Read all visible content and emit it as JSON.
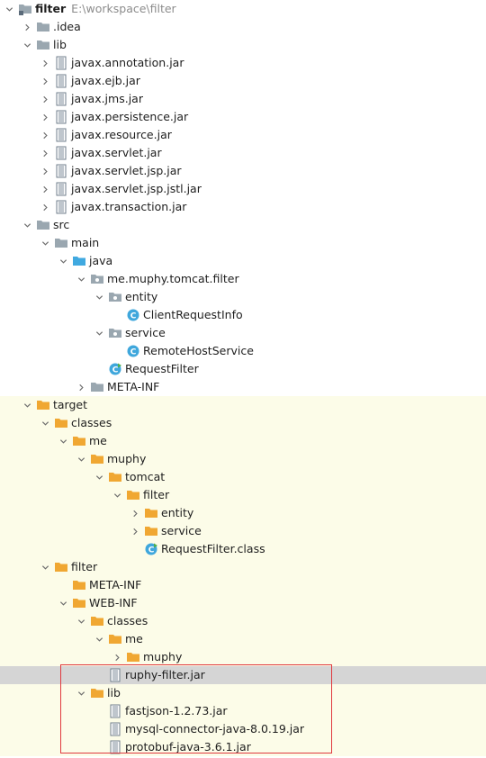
{
  "project": {
    "name": "filter",
    "path": "E:\\workspace\\filter"
  },
  "colors": {
    "folder_gray": "#9aa7b0",
    "folder_orange": "#f0a732",
    "folder_blue": "#40a9e0",
    "excluded_bg": "#fcfce8",
    "selected_bg": "#d5d5d5",
    "highlight_border": "#e0393e"
  },
  "tree": [
    {
      "label": "filter",
      "path": "E:\\workspace\\filter",
      "depth": 0,
      "icon": "module-folder-icon",
      "state": "expanded",
      "bold": true
    },
    {
      "label": ".idea",
      "depth": 1,
      "icon": "folder-icon",
      "state": "collapsed"
    },
    {
      "label": "lib",
      "depth": 1,
      "icon": "folder-icon",
      "state": "expanded"
    },
    {
      "label": "javax.annotation.jar",
      "depth": 2,
      "icon": "jar-icon",
      "state": "collapsed"
    },
    {
      "label": "javax.ejb.jar",
      "depth": 2,
      "icon": "jar-icon",
      "state": "collapsed"
    },
    {
      "label": "javax.jms.jar",
      "depth": 2,
      "icon": "jar-icon",
      "state": "collapsed"
    },
    {
      "label": "javax.persistence.jar",
      "depth": 2,
      "icon": "jar-icon",
      "state": "collapsed"
    },
    {
      "label": "javax.resource.jar",
      "depth": 2,
      "icon": "jar-icon",
      "state": "collapsed"
    },
    {
      "label": "javax.servlet.jar",
      "depth": 2,
      "icon": "jar-icon",
      "state": "collapsed"
    },
    {
      "label": "javax.servlet.jsp.jar",
      "depth": 2,
      "icon": "jar-icon",
      "state": "collapsed"
    },
    {
      "label": "javax.servlet.jsp.jstl.jar",
      "depth": 2,
      "icon": "jar-icon",
      "state": "collapsed"
    },
    {
      "label": "javax.transaction.jar",
      "depth": 2,
      "icon": "jar-icon",
      "state": "collapsed"
    },
    {
      "label": "src",
      "depth": 1,
      "icon": "folder-icon",
      "state": "expanded"
    },
    {
      "label": "main",
      "depth": 2,
      "icon": "folder-icon",
      "state": "expanded"
    },
    {
      "label": "java",
      "depth": 3,
      "icon": "source-root-folder-icon",
      "state": "expanded"
    },
    {
      "label": "me.muphy.tomcat.filter",
      "depth": 4,
      "icon": "package-icon",
      "state": "expanded"
    },
    {
      "label": "entity",
      "depth": 5,
      "icon": "package-icon",
      "state": "expanded"
    },
    {
      "label": "ClientRequestInfo",
      "depth": 6,
      "icon": "java-class-icon",
      "state": "leaf"
    },
    {
      "label": "service",
      "depth": 5,
      "icon": "package-icon",
      "state": "expanded"
    },
    {
      "label": "RemoteHostService",
      "depth": 6,
      "icon": "java-class-icon",
      "state": "leaf"
    },
    {
      "label": "RequestFilter",
      "depth": 5,
      "icon": "servlet-class-icon",
      "state": "leaf"
    },
    {
      "label": "META-INF",
      "depth": 4,
      "icon": "folder-icon",
      "state": "collapsed"
    },
    {
      "label": "target",
      "depth": 1,
      "icon": "excluded-folder-icon",
      "state": "expanded",
      "excluded": true
    },
    {
      "label": "classes",
      "depth": 2,
      "icon": "excluded-folder-icon",
      "state": "expanded",
      "excluded": true
    },
    {
      "label": "me",
      "depth": 3,
      "icon": "excluded-folder-icon",
      "state": "expanded",
      "excluded": true
    },
    {
      "label": "muphy",
      "depth": 4,
      "icon": "excluded-folder-icon",
      "state": "expanded",
      "excluded": true
    },
    {
      "label": "tomcat",
      "depth": 5,
      "icon": "excluded-folder-icon",
      "state": "expanded",
      "excluded": true
    },
    {
      "label": "filter",
      "depth": 6,
      "icon": "excluded-folder-icon",
      "state": "expanded",
      "excluded": true
    },
    {
      "label": "entity",
      "depth": 7,
      "icon": "excluded-folder-icon",
      "state": "collapsed",
      "excluded": true
    },
    {
      "label": "service",
      "depth": 7,
      "icon": "excluded-folder-icon",
      "state": "collapsed",
      "excluded": true
    },
    {
      "label": "RequestFilter.class",
      "depth": 7,
      "icon": "compiled-class-icon",
      "state": "leaf",
      "excluded": true
    },
    {
      "label": "filter",
      "depth": 2,
      "icon": "excluded-folder-icon",
      "state": "expanded",
      "excluded": true
    },
    {
      "label": "META-INF",
      "depth": 3,
      "icon": "excluded-folder-icon",
      "state": "leaf",
      "excluded": true
    },
    {
      "label": "WEB-INF",
      "depth": 3,
      "icon": "excluded-folder-icon",
      "state": "expanded",
      "excluded": true
    },
    {
      "label": "classes",
      "depth": 4,
      "icon": "excluded-folder-icon",
      "state": "expanded",
      "excluded": true
    },
    {
      "label": "me",
      "depth": 5,
      "icon": "excluded-folder-icon",
      "state": "expanded",
      "excluded": true
    },
    {
      "label": "muphy",
      "depth": 6,
      "icon": "excluded-folder-icon",
      "state": "collapsed",
      "excluded": true
    },
    {
      "label": "ruphy-filter.jar",
      "depth": 5,
      "icon": "jar-icon",
      "state": "leaf",
      "excluded": true,
      "selected": true
    },
    {
      "label": "lib",
      "depth": 4,
      "icon": "excluded-folder-icon",
      "state": "expanded",
      "excluded": true
    },
    {
      "label": "fastjson-1.2.73.jar",
      "depth": 5,
      "icon": "jar-icon",
      "state": "leaf",
      "excluded": true
    },
    {
      "label": "mysql-connector-java-8.0.19.jar",
      "depth": 5,
      "icon": "jar-icon",
      "state": "leaf",
      "excluded": true
    },
    {
      "label": "protobuf-java-3.6.1.jar",
      "depth": 5,
      "icon": "jar-icon",
      "state": "leaf",
      "excluded": true
    }
  ]
}
